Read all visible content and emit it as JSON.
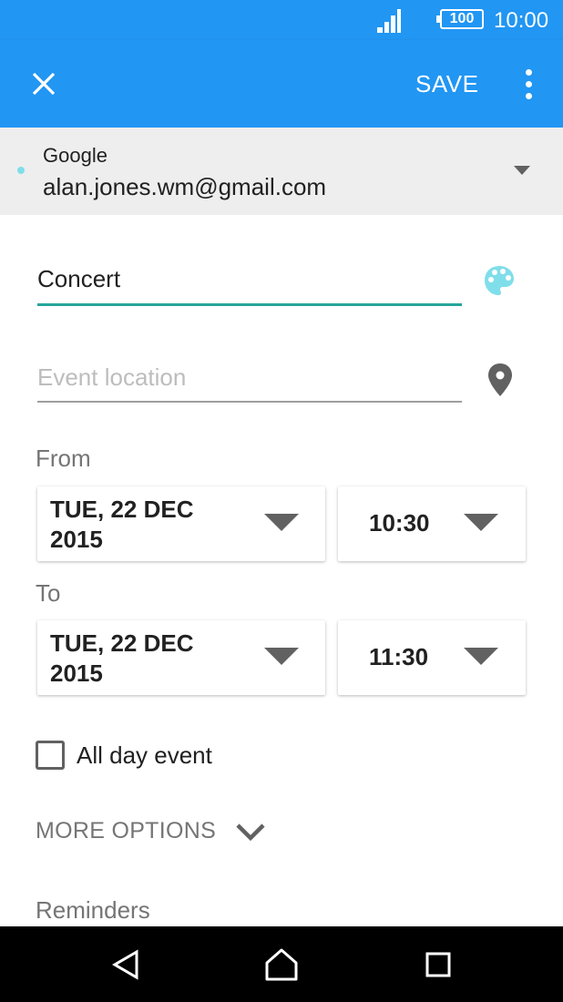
{
  "status_bar": {
    "battery": "100",
    "time": "10:00",
    "icons": [
      "signal-icon",
      "battery-icon"
    ]
  },
  "toolbar": {
    "close_icon": "close-icon",
    "save_label": "SAVE",
    "menu_icon": "more-vert-icon"
  },
  "account": {
    "provider": "Google",
    "email": "alan.jones.wm@gmail.com",
    "color": "#80deea"
  },
  "event": {
    "title": "Concert",
    "location_placeholder": "Event location",
    "location_value": ""
  },
  "from": {
    "label": "From",
    "date_line1": "TUE, 22 DEC",
    "date_line2": "2015",
    "time": "10:30"
  },
  "to": {
    "label": "To",
    "date_line1": "TUE, 22 DEC",
    "date_line2": "2015",
    "time": "11:30"
  },
  "all_day": {
    "label": "All day event",
    "checked": false
  },
  "more_options": {
    "label": "MORE OPTIONS"
  },
  "reminders": {
    "label": "Reminders"
  },
  "colors": {
    "app_bar": "#2196f3",
    "accent": "#26a69a",
    "account_band": "#eeeeee"
  }
}
